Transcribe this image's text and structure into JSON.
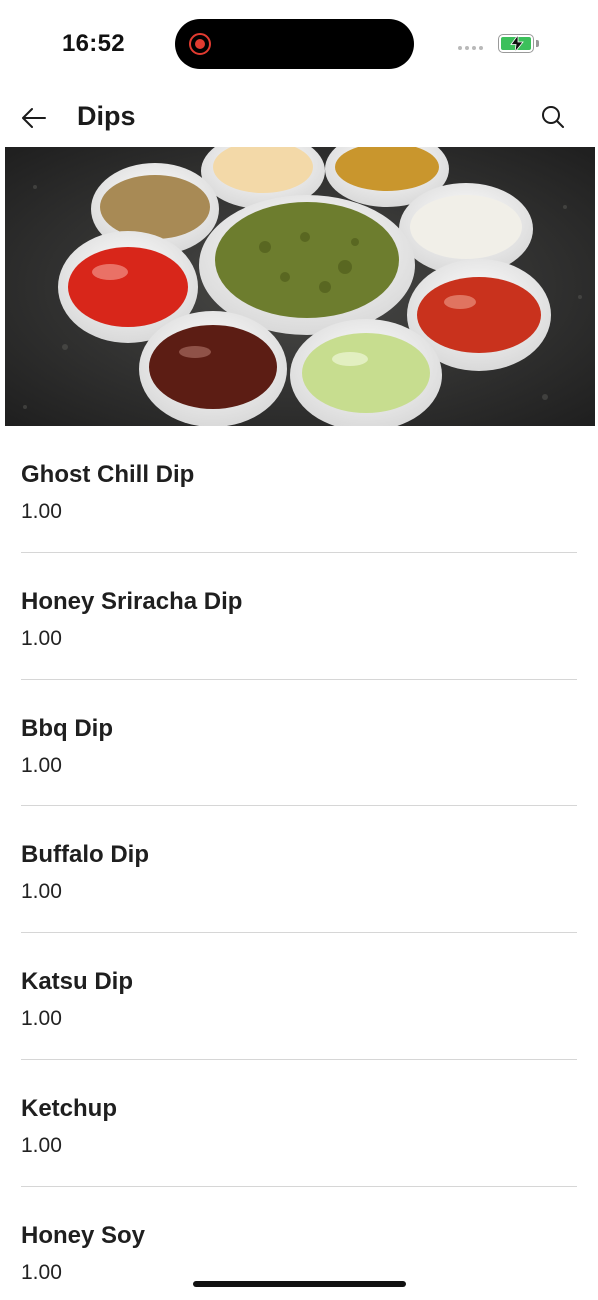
{
  "status_bar": {
    "time": "16:52",
    "icons": [
      "recording-indicator-icon",
      "signal-dots-icon",
      "battery-charging-icon"
    ]
  },
  "header": {
    "title": "Dips",
    "back_icon": "arrow-left-icon",
    "search_icon": "search-icon"
  },
  "hero_image": {
    "description_icon": "dip-bowls-photo"
  },
  "items": [
    {
      "name": "Ghost Chill Dip",
      "price": "1.00"
    },
    {
      "name": "Honey Sriracha Dip",
      "price": "1.00"
    },
    {
      "name": "Bbq Dip",
      "price": "1.00"
    },
    {
      "name": "Buffalo Dip",
      "price": "1.00"
    },
    {
      "name": "Katsu Dip",
      "price": "1.00"
    },
    {
      "name": "Ketchup",
      "price": "1.00"
    },
    {
      "name": "Honey Soy",
      "price": "1.00"
    }
  ],
  "colors": {
    "accent_record": "#e23b30",
    "battery_green": "#3cc05b",
    "divider": "#d6d6d6"
  }
}
